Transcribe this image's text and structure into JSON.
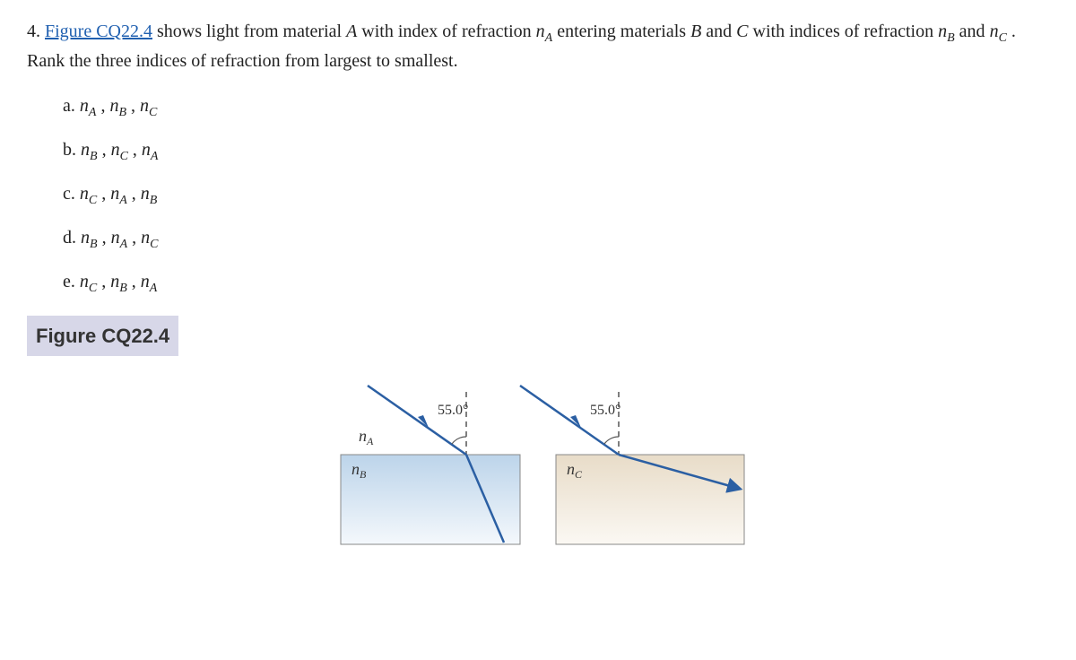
{
  "question": {
    "number": "4.",
    "link_text": "Figure CQ22.4",
    "text_before_link": " ",
    "text_after_link": " shows light from material ",
    "var_A": "A",
    "text2": " with index of refraction ",
    "n_A": "n",
    "text3": " entering materials ",
    "var_B": "B",
    "text4": " and ",
    "var_C": "C",
    "text5": " with indices of refraction ",
    "n_B": "n",
    "text6": " and ",
    "n_C": "n",
    "text7": " . Rank the three indices of refraction from largest to smallest."
  },
  "subs": {
    "A": "A",
    "B": "B",
    "C": "C"
  },
  "options": {
    "a": "a. ",
    "b": "b. ",
    "c": "c. ",
    "d": "d. ",
    "e": "e. "
  },
  "ranks": {
    "a": [
      "A",
      "B",
      "C"
    ],
    "b": [
      "B",
      "C",
      "A"
    ],
    "c": [
      "C",
      "A",
      "B"
    ],
    "d": [
      "B",
      "A",
      "C"
    ],
    "e": [
      "C",
      "B",
      "A"
    ]
  },
  "figure_label": "Figure CQ22.4",
  "diagram": {
    "angle_label_left": "55.0°",
    "angle_label_right": "55.0°",
    "label_nA": "n",
    "label_nA_sub": "A",
    "label_nB": "n",
    "label_nB_sub": "B",
    "label_nC": "n",
    "label_nC_sub": "C",
    "incidence_angle_deg": 55.0,
    "refraction_B_bends": "toward-normal",
    "refraction_C_bends": "away-from-normal"
  }
}
